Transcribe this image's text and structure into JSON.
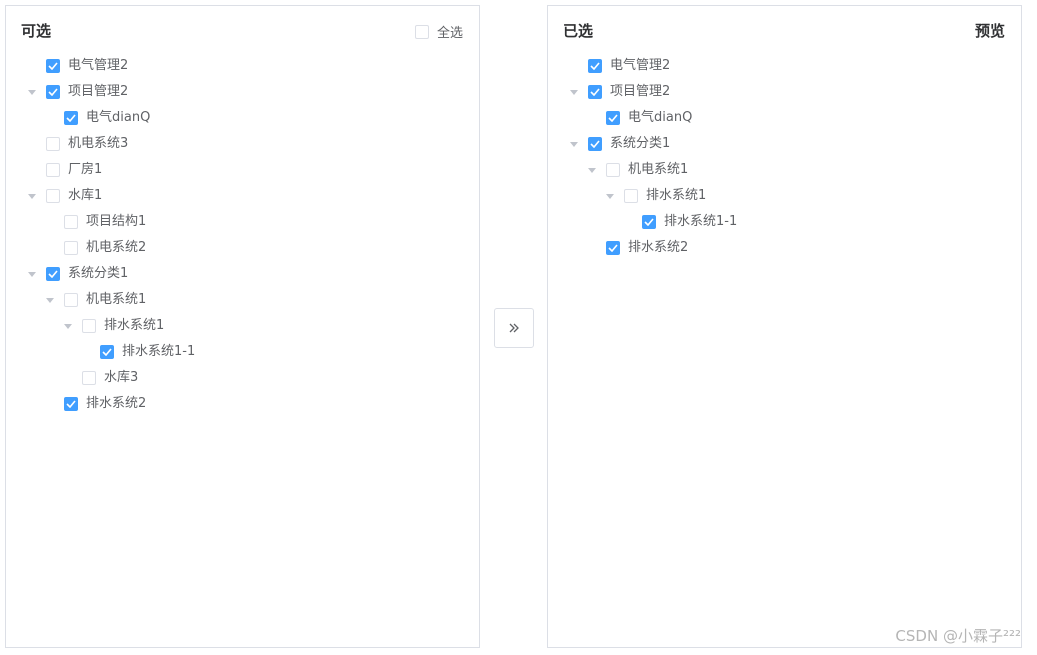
{
  "left": {
    "title": "可选",
    "select_all_label": "全选",
    "select_all_checked": false,
    "nodes": [
      {
        "label": "电气管理2",
        "depth": 0,
        "expandable": false,
        "checked": true
      },
      {
        "label": "项目管理2",
        "depth": 0,
        "expandable": true,
        "checked": true
      },
      {
        "label": "电气dianQ",
        "depth": 1,
        "expandable": false,
        "checked": true
      },
      {
        "label": "机电系统3",
        "depth": 0,
        "expandable": false,
        "checked": false
      },
      {
        "label": "厂房1",
        "depth": 0,
        "expandable": false,
        "checked": false
      },
      {
        "label": "水库1",
        "depth": 0,
        "expandable": true,
        "checked": false
      },
      {
        "label": "项目结构1",
        "depth": 1,
        "expandable": false,
        "checked": false
      },
      {
        "label": "机电系统2",
        "depth": 1,
        "expandable": false,
        "checked": false
      },
      {
        "label": "系统分类1",
        "depth": 0,
        "expandable": true,
        "checked": true
      },
      {
        "label": "机电系统1",
        "depth": 1,
        "expandable": true,
        "checked": false
      },
      {
        "label": "排水系统1",
        "depth": 2,
        "expandable": true,
        "checked": false
      },
      {
        "label": "排水系统1-1",
        "depth": 3,
        "expandable": false,
        "checked": true
      },
      {
        "label": "水库3",
        "depth": 2,
        "expandable": false,
        "checked": false
      },
      {
        "label": "排水系统2",
        "depth": 1,
        "expandable": false,
        "checked": true
      }
    ]
  },
  "transfer_button": {
    "icon": "double-chevron-right-icon",
    "glyph": "»"
  },
  "right": {
    "title": "已选",
    "preview_label": "预览",
    "nodes": [
      {
        "label": "电气管理2",
        "depth": 0,
        "expandable": false,
        "checked": true
      },
      {
        "label": "项目管理2",
        "depth": 0,
        "expandable": true,
        "checked": true
      },
      {
        "label": "电气dianQ",
        "depth": 1,
        "expandable": false,
        "checked": true
      },
      {
        "label": "系统分类1",
        "depth": 0,
        "expandable": true,
        "checked": true
      },
      {
        "label": "机电系统1",
        "depth": 1,
        "expandable": true,
        "checked": false
      },
      {
        "label": "排水系统1",
        "depth": 2,
        "expandable": true,
        "checked": false
      },
      {
        "label": "排水系统1-1",
        "depth": 3,
        "expandable": false,
        "checked": true
      },
      {
        "label": "排水系统2",
        "depth": 1,
        "expandable": false,
        "checked": true
      }
    ]
  },
  "watermark": "CSDN @小霖子²²²",
  "colors": {
    "accent": "#409eff",
    "border": "#dcdfe6",
    "text": "#606266",
    "title": "#303133"
  }
}
